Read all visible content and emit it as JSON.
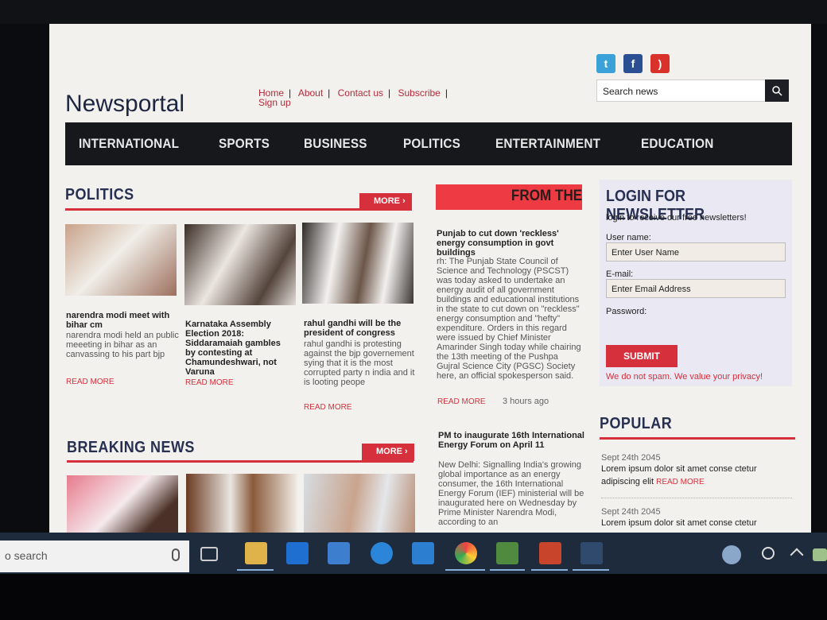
{
  "site": {
    "logo": "Newsportal",
    "top_links": [
      "Home",
      "About",
      "Contact us",
      "Subscribe",
      "Sign up"
    ],
    "search_placeholder": "Search news",
    "social": [
      "twitter-icon",
      "facebook-icon",
      "rss-icon"
    ]
  },
  "nav": [
    "INTERNATIONAL",
    "SPORTS",
    "BUSINESS",
    "POLITICS",
    "ENTERTAINMENT",
    "EDUCATION"
  ],
  "politics": {
    "title": "POLITICS",
    "more": "MORE",
    "articles": [
      {
        "title": "narendra modi meet with bihar cm",
        "body": "narendra modi held an public meeeting in bihar as an canvassing to his part bjp",
        "read_more": "READ MORE"
      },
      {
        "title": "Karnataka Assembly Election 2018: Siddaramaiah gambles by contesting at Chamundeshwari, not Varuna",
        "body": "",
        "read_more": "READ MORE"
      },
      {
        "title": "rahul gandhi will be the president of congress",
        "body": "rahul gandhi is protesting against the bjp governement sying that it is the most corrupted party n india and it is looting peope",
        "read_more": "READ MORE"
      }
    ]
  },
  "from_the": {
    "banner": "FROM THE",
    "articles": [
      {
        "title": "Punjab to cut down 'reckless' energy consumption in govt buildings",
        "body": "rh: The Punjab State Council of Science and Technology (PSCST) was today asked to undertake an energy audit of all government buildings and educational institutions in the state to cut down on \"reckless\" energy consumption and \"hefty\" expenditure. Orders in this regard were issued by Chief Minister Amarinder Singh today while chairing the 13th meeting of the Pushpa Gujral Science City (PGSC) Society here, an official spokesperson said.",
        "read_more": "READ MORE",
        "time": "3 hours ago"
      },
      {
        "title": "PM to inaugurate 16th International Energy Forum on April 11",
        "body": "New Delhi: Signalling India's growing global importance as an energy consumer, the 16th International Energy Forum (IEF) ministerial will be inaugurated here on Wednesday by Prime Minister Narendra Modi, according to an"
      }
    ]
  },
  "breaking": {
    "title": "BREAKING NEWS",
    "more": "MORE"
  },
  "newsletter": {
    "title": "LOGIN FOR NEWSLETTER",
    "subtitle": "login to receive our free newsletters!",
    "username_label": "User name:",
    "username_placeholder": "Enter User Name",
    "email_label": "E-mail:",
    "email_placeholder": "Enter Email Address",
    "password_label": "Password:",
    "submit": "SUBMIT",
    "privacy": "We do not spam. We value your privacy!"
  },
  "popular": {
    "title": "POPULAR",
    "items": [
      {
        "date": "Sept 24th 2045",
        "text": "Lorem ipsum dolor sit amet conse ctetur adipiscing elit",
        "read_more": "READ MORE"
      },
      {
        "date": "Sept 24th 2045",
        "text": "Lorem ipsum dolor sit amet conse ctetur"
      }
    ]
  },
  "taskbar": {
    "search_text": "o search"
  }
}
